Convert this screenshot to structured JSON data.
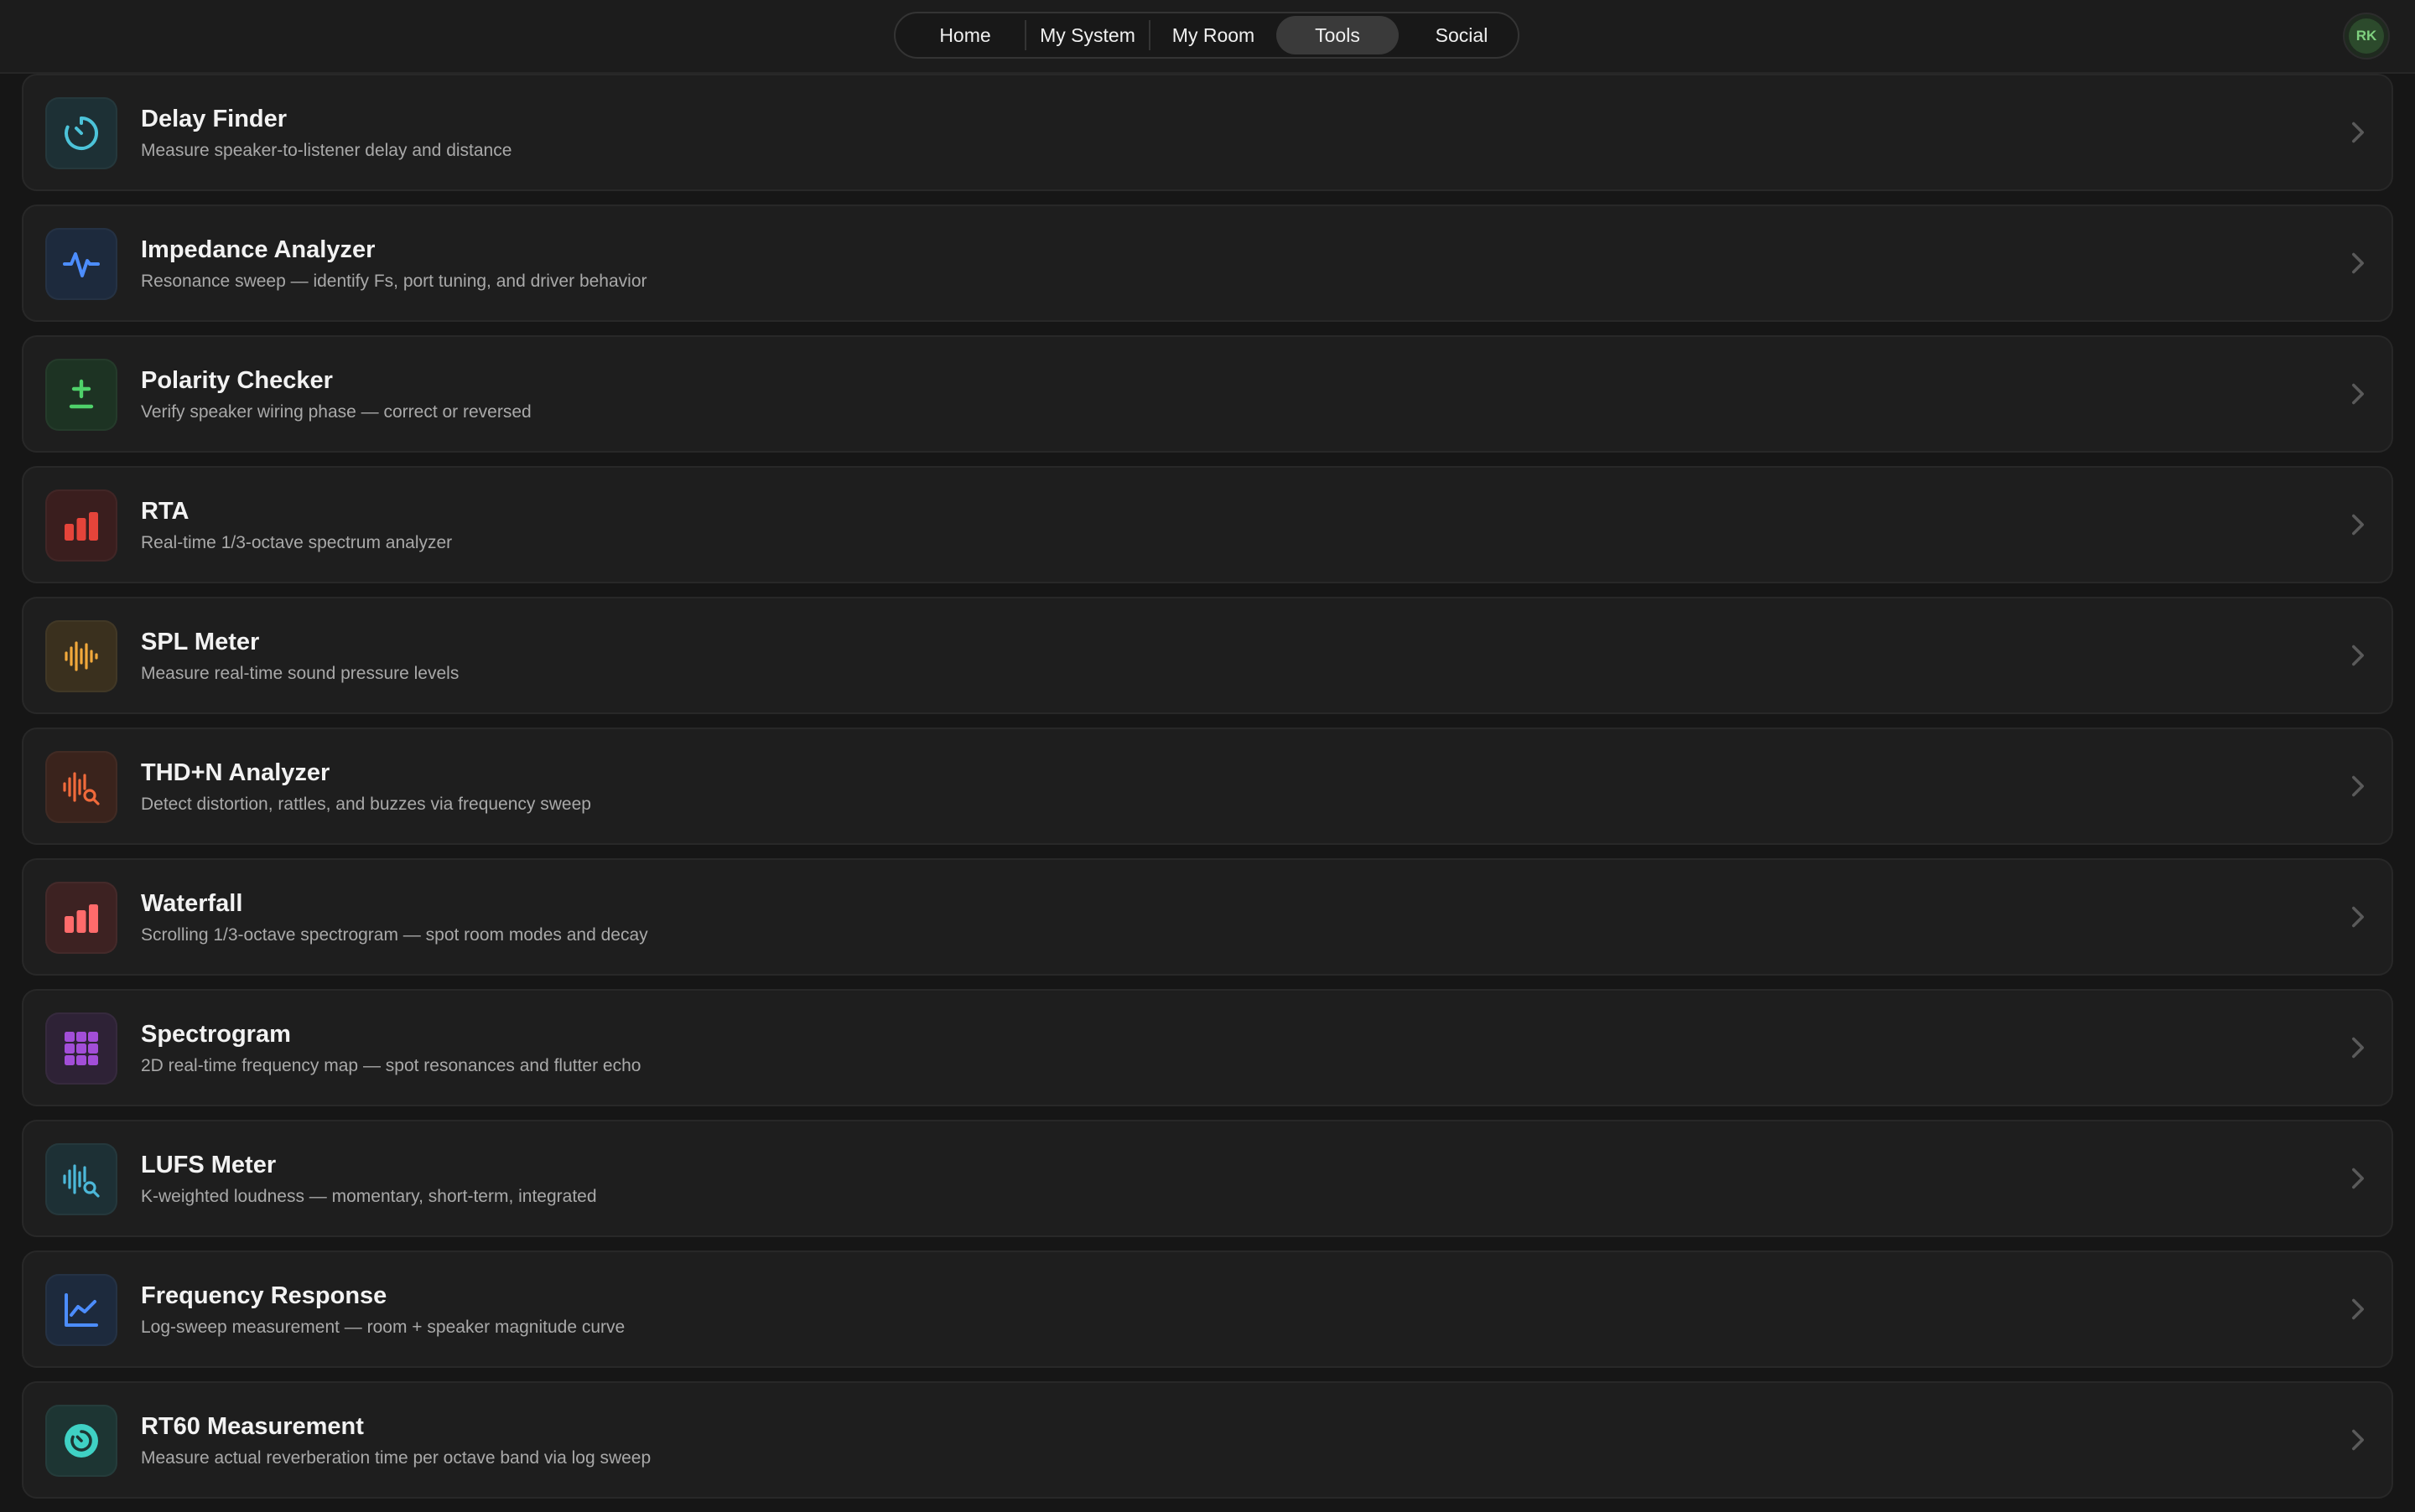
{
  "nav": {
    "tabs": [
      {
        "label": "Home"
      },
      {
        "label": "My System"
      },
      {
        "label": "My Room"
      },
      {
        "label": "Tools"
      },
      {
        "label": "Social"
      }
    ],
    "active_tab": "Tools"
  },
  "user": {
    "initials": "RK"
  },
  "tools": [
    {
      "title": "Delay Finder",
      "subtitle": "Measure speaker-to-listener delay and distance",
      "icon": "stopwatch-icon",
      "accent": "#4cc3d9",
      "bg": "#1d3035"
    },
    {
      "title": "Impedance Analyzer",
      "subtitle": "Resonance sweep — identify Fs, port tuning, and driver behavior",
      "icon": "pulse-icon",
      "accent": "#4c8dff",
      "bg": "#1d2a3d"
    },
    {
      "title": "Polarity Checker",
      "subtitle": "Verify speaker wiring phase — correct or reversed",
      "icon": "plus-minus-icon",
      "accent": "#4fd16a",
      "bg": "#1d3323"
    },
    {
      "title": "RTA",
      "subtitle": "Real-time 1/3-octave spectrum analyzer",
      "icon": "bar-chart-icon",
      "accent": "#e5443a",
      "bg": "#3a1e1e"
    },
    {
      "title": "SPL Meter",
      "subtitle": "Measure real-time sound pressure levels",
      "icon": "waveform-icon",
      "accent": "#f2a93b",
      "bg": "#3a301e"
    },
    {
      "title": "THD+N Analyzer",
      "subtitle": "Detect distortion, rattles, and buzzes via frequency sweep",
      "icon": "waveform-search-icon",
      "accent": "#f06a3b",
      "bg": "#3a231c"
    },
    {
      "title": "Waterfall",
      "subtitle": "Scrolling 1/3-octave spectrogram — spot room modes and decay",
      "icon": "bar-chart-icon",
      "accent": "#ff6b6b",
      "bg": "#3d2222"
    },
    {
      "title": "Spectrogram",
      "subtitle": "2D real-time frequency map — spot resonances and flutter echo",
      "icon": "grid-icon",
      "accent": "#a24ed8",
      "bg": "#2e2236"
    },
    {
      "title": "LUFS Meter",
      "subtitle": "K-weighted loudness — momentary, short-term, integrated",
      "icon": "waveform-search-icon",
      "accent": "#4cb8d9",
      "bg": "#1d3035"
    },
    {
      "title": "Frequency Response",
      "subtitle": "Log-sweep measurement — room + speaker magnitude curve",
      "icon": "line-chart-icon",
      "accent": "#4c8dff",
      "bg": "#1d2a3d"
    },
    {
      "title": "RT60 Measurement",
      "subtitle": "Measure actual reverberation time per octave band via log sweep",
      "icon": "reverb-timer-icon",
      "accent": "#3fd1c4",
      "bg": "#1d3533"
    }
  ]
}
